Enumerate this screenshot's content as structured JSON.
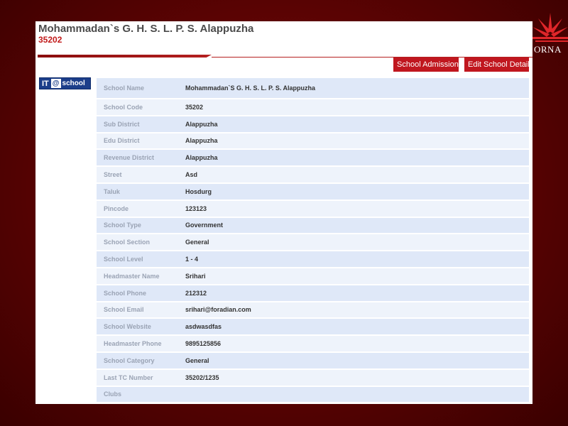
{
  "brand": {
    "text": "ORNA"
  },
  "header": {
    "title": "Mohammadan`s G. H. S. L. P. S. Alappuzha",
    "code": "35202"
  },
  "actions": {
    "admission_label": "School Admission",
    "edit_label": "Edit School Detail"
  },
  "logo": {
    "it": "IT",
    "at": "@",
    "school": "school"
  },
  "details": [
    {
      "label": "School Name",
      "value": "Mohammadan`S G. H. S. L. P. S. Alappuzha"
    },
    {
      "label": "School Code",
      "value": "35202"
    },
    {
      "label": "Sub District",
      "value": "Alappuzha"
    },
    {
      "label": "Edu District",
      "value": "Alappuzha"
    },
    {
      "label": "Revenue District",
      "value": "Alappuzha"
    },
    {
      "label": "Street",
      "value": "Asd"
    },
    {
      "label": "Taluk",
      "value": "Hosdurg"
    },
    {
      "label": "Pincode",
      "value": "123123"
    },
    {
      "label": "School Type",
      "value": "Government"
    },
    {
      "label": "School Section",
      "value": "General"
    },
    {
      "label": "School Level",
      "value": "1 - 4"
    },
    {
      "label": "Headmaster Name",
      "value": "Srihari"
    },
    {
      "label": "School Phone",
      "value": "212312"
    },
    {
      "label": "School Email",
      "value": "srihari@foradian.com"
    },
    {
      "label": "School Website",
      "value": "asdwasdfas"
    },
    {
      "label": "Headmaster Phone",
      "value": "9895125856"
    },
    {
      "label": "School Category",
      "value": "General"
    },
    {
      "label": "Last TC Number",
      "value": "35202/1235"
    },
    {
      "label": "Clubs",
      "value": ""
    }
  ],
  "colors": {
    "accent": "#c0171f",
    "row_odd": "#dfe8f8",
    "row_even": "#eef3fb",
    "background": "#5a0303"
  }
}
